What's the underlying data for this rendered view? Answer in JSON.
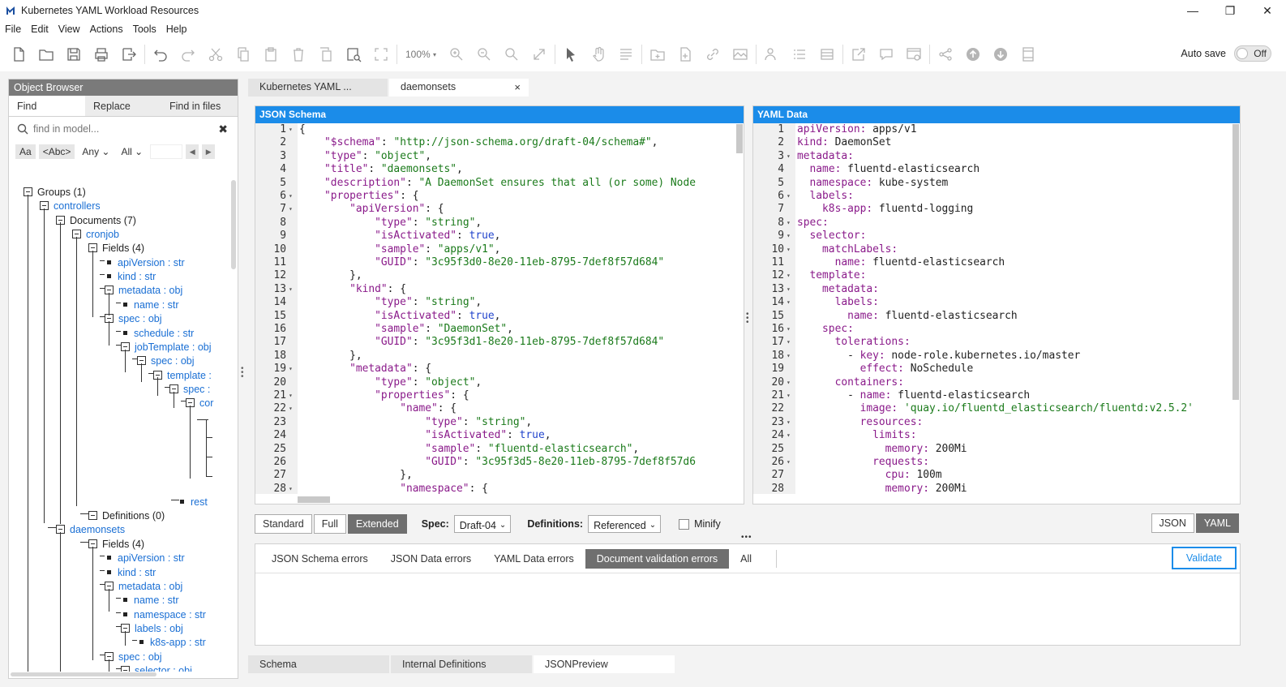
{
  "window": {
    "title": "Kubernetes YAML Workload Resources",
    "minimize": "—",
    "maximize": "❐",
    "close": "✕"
  },
  "menu": [
    "File",
    "Edit",
    "View",
    "Actions",
    "Tools",
    "Help"
  ],
  "toolbar": {
    "zoom": "100%",
    "autosave_label": "Auto save",
    "autosave_state": "Off"
  },
  "object_browser": {
    "title": "Object Browser",
    "tabs": [
      "Find",
      "Replace",
      "Find in files"
    ],
    "search_placeholder": "find in model...",
    "options": [
      "Aa",
      "<Abc>",
      "Any",
      "All"
    ],
    "tree": [
      {
        "label": "Groups (1)",
        "blue": false
      },
      {
        "label": "controllers",
        "blue": true
      },
      {
        "label": "Documents (7)",
        "blue": false
      },
      {
        "label": "cronjob",
        "blue": true
      },
      {
        "label": "Fields (4)",
        "blue": false
      },
      {
        "label": "apiVersion : str",
        "blue": true
      },
      {
        "label": "kind : str",
        "blue": true
      },
      {
        "label": "metadata : obj",
        "blue": true
      },
      {
        "label": "name : str",
        "blue": true
      },
      {
        "label": "spec : obj",
        "blue": true
      },
      {
        "label": "schedule : str",
        "blue": true
      },
      {
        "label": "jobTemplate : obj",
        "blue": true
      },
      {
        "label": "spec : obj",
        "blue": true
      },
      {
        "label": "template :",
        "blue": true
      },
      {
        "label": "spec :",
        "blue": true
      },
      {
        "label": "cor",
        "blue": true
      },
      {
        "label": "rest",
        "blue": true
      },
      {
        "label": "Definitions (0)",
        "blue": false
      },
      {
        "label": "daemonsets",
        "blue": true
      },
      {
        "label": "Fields (4)",
        "blue": false
      },
      {
        "label": "apiVersion : str",
        "blue": true
      },
      {
        "label": "kind : str",
        "blue": true
      },
      {
        "label": "metadata : obj",
        "blue": true
      },
      {
        "label": "name : str",
        "blue": true
      },
      {
        "label": "namespace : str",
        "blue": true
      },
      {
        "label": "labels : obj",
        "blue": true
      },
      {
        "label": "k8s-app : str",
        "blue": true
      },
      {
        "label": "spec : obj",
        "blue": true
      },
      {
        "label": "selector : obj",
        "blue": true
      }
    ]
  },
  "doc_tabs": [
    {
      "label": "Kubernetes YAML ..."
    },
    {
      "label": "daemonsets",
      "close": "×"
    }
  ],
  "json_schema": {
    "title": "JSON Schema",
    "lines": [
      "{",
      "    \"$schema\": \"http://json-schema.org/draft-04/schema#\",",
      "    \"type\": \"object\",",
      "    \"title\": \"daemonsets\",",
      "    \"description\": \"A DaemonSet ensures that all (or some) Node",
      "    \"properties\": {",
      "        \"apiVersion\": {",
      "            \"type\": \"string\",",
      "            \"isActivated\": true,",
      "            \"sample\": \"apps/v1\",",
      "            \"GUID\": \"3c95f3d0-8e20-11eb-8795-7def8f57d684\"",
      "        },",
      "        \"kind\": {",
      "            \"type\": \"string\",",
      "            \"isActivated\": true,",
      "            \"sample\": \"DaemonSet\",",
      "            \"GUID\": \"3c95f3d1-8e20-11eb-8795-7def8f57d684\"",
      "        },",
      "        \"metadata\": {",
      "            \"type\": \"object\",",
      "            \"properties\": {",
      "                \"name\": {",
      "                    \"type\": \"string\",",
      "                    \"isActivated\": true,",
      "                    \"sample\": \"fluentd-elasticsearch\",",
      "                    \"GUID\": \"3c95f3d5-8e20-11eb-8795-7def8f57d6",
      "                },",
      "                \"namespace\": {",
      ""
    ]
  },
  "yaml_data": {
    "title": "YAML Data",
    "lines": [
      "apiVersion: apps/v1",
      "kind: DaemonSet",
      "metadata:",
      "  name: fluentd-elasticsearch",
      "  namespace: kube-system",
      "  labels:",
      "    k8s-app: fluentd-logging",
      "spec:",
      "  selector:",
      "    matchLabels:",
      "      name: fluentd-elasticsearch",
      "  template:",
      "    metadata:",
      "      labels:",
      "        name: fluentd-elasticsearch",
      "    spec:",
      "      tolerations:",
      "        - key: node-role.kubernetes.io/master",
      "          effect: NoSchedule",
      "      containers:",
      "        - name: fluentd-elasticsearch",
      "          image: 'quay.io/fluentd_elasticsearch/fluentd:v2.5.2'",
      "          resources:",
      "            limits:",
      "              memory: 200Mi",
      "            requests:",
      "              cpu: 100m",
      "              memory: 200Mi",
      ""
    ]
  },
  "options": {
    "modes": [
      "Standard",
      "Full",
      "Extended"
    ],
    "active_mode": "Extended",
    "spec_label": "Spec:",
    "spec_value": "Draft-04",
    "definitions_label": "Definitions:",
    "definitions_value": "Referenced",
    "minify_label": "Minify",
    "formats": [
      "JSON",
      "YAML"
    ],
    "active_format": "YAML"
  },
  "errors": {
    "tabs": [
      "JSON Schema errors",
      "JSON Data errors",
      "YAML Data errors",
      "Document validation errors",
      "All"
    ],
    "active_tab": "Document validation errors",
    "validate_label": "Validate"
  },
  "bottom_tabs": [
    "Schema",
    "Internal Definitions",
    "JSONPreview"
  ],
  "colors": {
    "accent": "#1b8ce9",
    "link": "#1a6fd4",
    "active_segment": "#6f6f6f"
  }
}
